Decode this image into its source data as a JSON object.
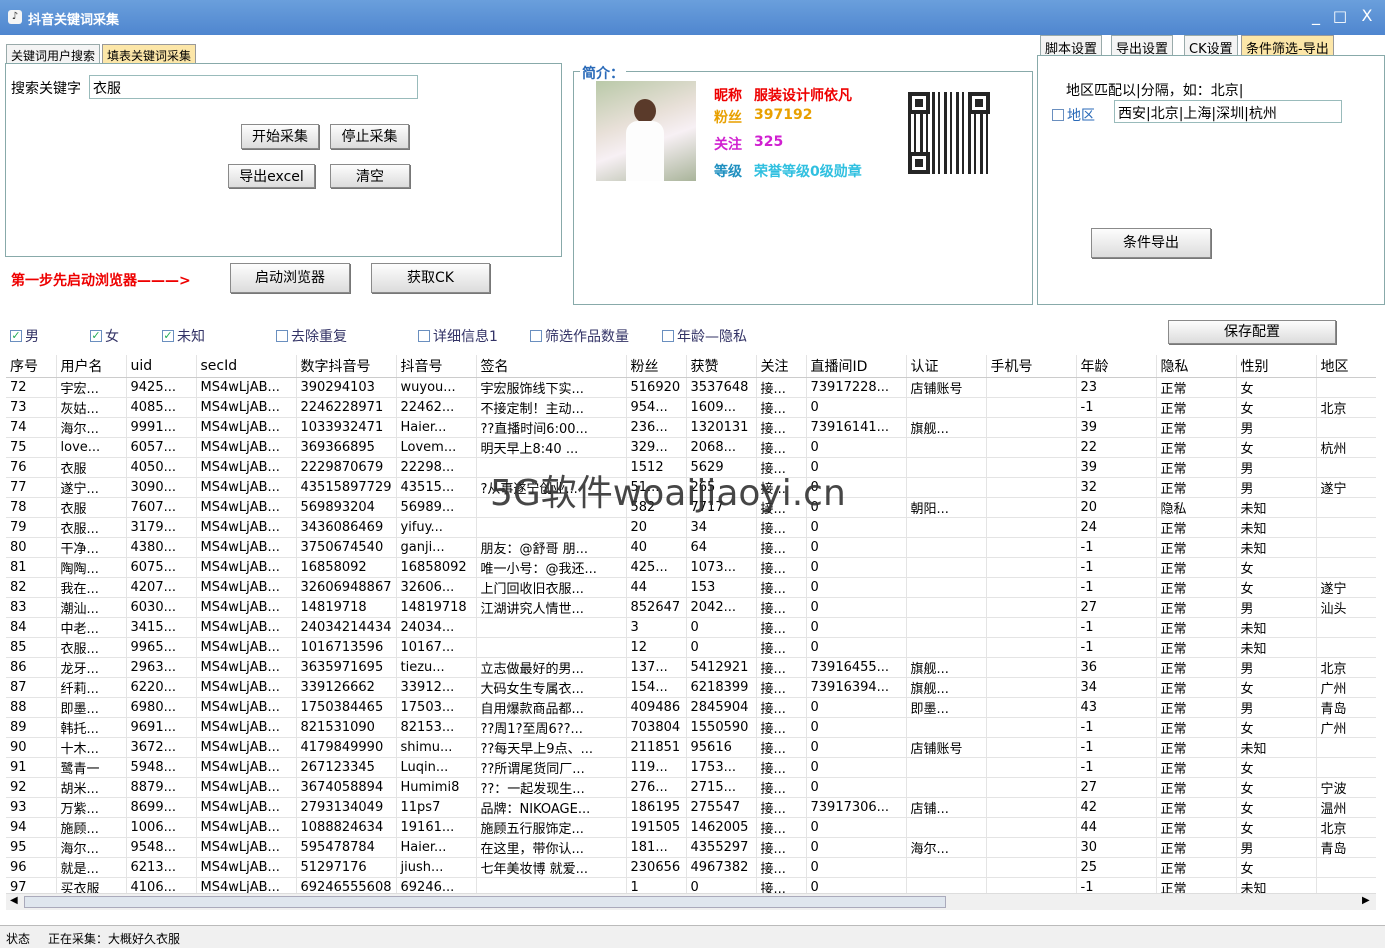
{
  "app": {
    "title": "抖音关键词采集",
    "icon": "music-note-icon",
    "minimize": "_",
    "maximize": "□",
    "close": "X"
  },
  "left_tabs": [
    "关键词用户搜索",
    "填表关键词采集"
  ],
  "search": {
    "label": "搜索关键字",
    "value": "衣服"
  },
  "buttons": {
    "start": "开始采集",
    "stop": "停止采集",
    "export": "导出excel",
    "clear": "清空",
    "browser": "启动浏览器",
    "getck": "获取CK",
    "filter_export": "条件导出",
    "save": "保存配置"
  },
  "step_hint": "第一步先启动浏览器———>",
  "profile": {
    "section": "简介：",
    "nick_label": "昵称",
    "nick": "服装设计师依凡",
    "fans_label": "粉丝",
    "fans": "397192",
    "follow_label": "关注",
    "follow": "325",
    "level_label": "等级",
    "level": "荣誉等级0级勋章"
  },
  "right_tabs": [
    "脚本设置",
    "导出设置",
    "CK设置",
    "条件筛选-导出"
  ],
  "region": {
    "hint": "地区匹配以|分隔，如：北京|",
    "label": "地区",
    "value": "西安|北京|上海|深圳|杭州",
    "checked": false
  },
  "filters": [
    {
      "label": "男",
      "checked": true
    },
    {
      "label": "女",
      "checked": true
    },
    {
      "label": "未知",
      "checked": true
    },
    {
      "label": "去除重复",
      "checked": false
    },
    {
      "label": "详细信息1",
      "checked": false
    },
    {
      "label": "筛选作品数量",
      "checked": false
    },
    {
      "label": "年龄—隐私",
      "checked": false
    }
  ],
  "columns": [
    "序号",
    "用户名",
    "uid",
    "secId",
    "数字抖音号",
    "抖音号",
    "签名",
    "粉丝",
    "获赞",
    "关注",
    "直播间ID",
    "认证",
    "手机号",
    "年龄",
    "隐私",
    "性别",
    "地区"
  ],
  "rows": [
    [
      "72",
      "宇宏...",
      "9425...",
      "MS4wLjAB...",
      "390294103",
      "wuyou...",
      "宇宏服饰线下实...",
      "516920",
      "3537648",
      "接...",
      "73917228...",
      "店铺账号",
      "",
      "23",
      "正常",
      "女",
      ""
    ],
    [
      "73",
      "灰姑...",
      "4085...",
      "MS4wLjAB...",
      "2246228971",
      "22462...",
      "不接定制！主动...",
      "954...",
      "1609...",
      "接...",
      "0",
      "",
      "",
      "-1",
      "正常",
      "女",
      "北京"
    ],
    [
      "74",
      "海尔...",
      "9991...",
      "MS4wLjAB...",
      "1033932471",
      "Haier...",
      "??直播时间6:00...",
      "236...",
      "1320131",
      "接...",
      "73916141...",
      "旗舰...",
      "",
      "39",
      "正常",
      "男",
      ""
    ],
    [
      "75",
      "love...",
      "6057...",
      "MS4wLjAB...",
      "369366895",
      "Lovem...",
      "明天早上8:40 ...",
      "329...",
      "2068...",
      "接...",
      "0",
      "",
      "",
      "22",
      "正常",
      "女",
      "杭州"
    ],
    [
      "76",
      "衣服",
      "4050...",
      "MS4wLjAB...",
      "2229870679",
      "22298...",
      "",
      "1512",
      "5629",
      "接...",
      "0",
      "",
      "",
      "39",
      "正常",
      "男",
      ""
    ],
    [
      "77",
      "遂宁...",
      "3090...",
      "MS4wLjAB...",
      "43515897729",
      "43515...",
      "?从事遂宁创业...",
      "51...",
      "265",
      "接...",
      "0",
      "",
      "",
      "32",
      "正常",
      "男",
      "遂宁"
    ],
    [
      "78",
      "衣服",
      "7607...",
      "MS4wLjAB...",
      "569893204",
      "56989...",
      "",
      "582",
      "7717",
      "接...",
      "0",
      "朝阳...",
      "",
      "20",
      "隐私",
      "未知",
      ""
    ],
    [
      "79",
      "衣服...",
      "3179...",
      "MS4wLjAB...",
      "3436086469",
      "yifuy...",
      "",
      "20",
      "34",
      "接...",
      "0",
      "",
      "",
      "24",
      "正常",
      "未知",
      ""
    ],
    [
      "80",
      "干净...",
      "4380...",
      "MS4wLjAB...",
      "3750674540",
      "ganji...",
      "朋友：@舒哥 朋...",
      "40",
      "64",
      "接...",
      "0",
      "",
      "",
      "-1",
      "正常",
      "未知",
      ""
    ],
    [
      "81",
      "陶陶...",
      "6075...",
      "MS4wLjAB...",
      "16858092",
      "16858092",
      "唯一小号：@我还...",
      "425...",
      "1073...",
      "接...",
      "0",
      "",
      "",
      "-1",
      "正常",
      "女",
      ""
    ],
    [
      "82",
      "我在...",
      "4207...",
      "MS4wLjAB...",
      "32606948867",
      "32606...",
      "上门回收旧衣服...",
      "44",
      "153",
      "接...",
      "0",
      "",
      "",
      "-1",
      "正常",
      "女",
      "遂宁"
    ],
    [
      "83",
      "潮汕...",
      "6030...",
      "MS4wLjAB...",
      "14819718",
      "14819718",
      "江湖讲究人情世...",
      "852647",
      "2042...",
      "接...",
      "0",
      "",
      "",
      "27",
      "正常",
      "男",
      "汕头"
    ],
    [
      "84",
      "中老...",
      "3415...",
      "MS4wLjAB...",
      "24034214434",
      "24034...",
      "",
      "3",
      "0",
      "接...",
      "0",
      "",
      "",
      "-1",
      "正常",
      "未知",
      ""
    ],
    [
      "85",
      "衣服...",
      "9965...",
      "MS4wLjAB...",
      "1016713596",
      "10167...",
      "",
      "12",
      "0",
      "接...",
      "0",
      "",
      "",
      "-1",
      "正常",
      "未知",
      ""
    ],
    [
      "86",
      "龙牙...",
      "2963...",
      "MS4wLjAB...",
      "3635971695",
      "tiezu...",
      "立志做最好的男...",
      "137...",
      "5412921",
      "接...",
      "73916455...",
      "旗舰...",
      "",
      "36",
      "正常",
      "男",
      "北京"
    ],
    [
      "87",
      "纤莉...",
      "6220...",
      "MS4wLjAB...",
      "339126662",
      "33912...",
      "大码女生专属衣...",
      "154...",
      "6218399",
      "接...",
      "73916394...",
      "旗舰...",
      "",
      "34",
      "正常",
      "女",
      "广州"
    ],
    [
      "88",
      "即墨...",
      "6980...",
      "MS4wLjAB...",
      "1750384465",
      "17503...",
      "自用爆款商品都...",
      "409486",
      "2845904",
      "接...",
      "0",
      "即墨...",
      "",
      "43",
      "正常",
      "男",
      "青岛"
    ],
    [
      "89",
      "韩托...",
      "9691...",
      "MS4wLjAB...",
      "821531090",
      "82153...",
      "??周1?至周6??...",
      "703804",
      "1550590",
      "接...",
      "0",
      "",
      "",
      "-1",
      "正常",
      "女",
      "广州"
    ],
    [
      "90",
      "十木...",
      "3672...",
      "MS4wLjAB...",
      "4179849990",
      "shimu...",
      "??每天早上9点、...",
      "211851",
      "95616",
      "接...",
      "0",
      "店铺账号",
      "",
      "-1",
      "正常",
      "未知",
      ""
    ],
    [
      "91",
      "鹭青一",
      "5948...",
      "MS4wLjAB...",
      "267123345",
      "Luqin...",
      "??所谓尾货同厂...",
      "119...",
      "1753...",
      "接...",
      "0",
      "",
      "",
      "-1",
      "正常",
      "女",
      ""
    ],
    [
      "92",
      "胡米...",
      "8879...",
      "MS4wLjAB...",
      "3674058894",
      "Humimi8",
      "??：一起发现生...",
      "276...",
      "2715...",
      "接...",
      "0",
      "",
      "",
      "27",
      "正常",
      "女",
      "宁波"
    ],
    [
      "93",
      "万紫...",
      "8699...",
      "MS4wLjAB...",
      "2793134049",
      "11ps7",
      "品牌：NIKOAGE...",
      "186195",
      "275547",
      "接...",
      "73917306...",
      "店铺...",
      "",
      "42",
      "正常",
      "女",
      "温州"
    ],
    [
      "94",
      "施顾...",
      "1006...",
      "MS4wLjAB...",
      "1088824634",
      "19161...",
      "施顾五行服饰定...",
      "191505",
      "1462005",
      "接...",
      "0",
      "",
      "",
      "44",
      "正常",
      "女",
      "北京"
    ],
    [
      "95",
      "海尔...",
      "9548...",
      "MS4wLjAB...",
      "595478784",
      "Haier...",
      "在这里，带你认...",
      "181...",
      "4355297",
      "接...",
      "0",
      "海尔...",
      "",
      "30",
      "正常",
      "男",
      "青岛"
    ],
    [
      "96",
      "就是...",
      "6213...",
      "MS4wLjAB...",
      "51297176",
      "jiush...",
      "七年美妆博 就爱...",
      "230656",
      "4967382",
      "接...",
      "0",
      "",
      "",
      "25",
      "正常",
      "女",
      ""
    ],
    [
      "97",
      "买衣服",
      "4106...",
      "MS4wLjAB...",
      "69246555608",
      "69246...",
      "",
      "1",
      "0",
      "接...",
      "0",
      "",
      "",
      "-1",
      "正常",
      "未知",
      ""
    ],
    [
      "98",
      "温暖...",
      "4416...",
      "MS4wLjAB...",
      "4128120485",
      "wennu...",
      "",
      "6",
      "0",
      "接...",
      "0",
      "",
      "",
      "-1",
      "正常",
      "未知",
      ""
    ],
    [
      "99",
      "衣服...",
      "1363...",
      "MS4wLjAB...",
      "79385311172",
      "79385...",
      "",
      "1",
      "0",
      "接...",
      "0",
      "",
      "",
      "",
      "",
      "未知",
      ""
    ],
    [
      "100",
      "大概...",
      "2406...",
      "MS4wLjAB...",
      "91312879830",
      "91312...",
      "",
      "2",
      "0",
      "接...",
      "0",
      "",
      "",
      "",
      "",
      "未知",
      ""
    ]
  ],
  "watermark": "5G软件woaijiaoyi.cn",
  "status": {
    "label": "状态",
    "text": "正在采集：大概好久衣服"
  }
}
